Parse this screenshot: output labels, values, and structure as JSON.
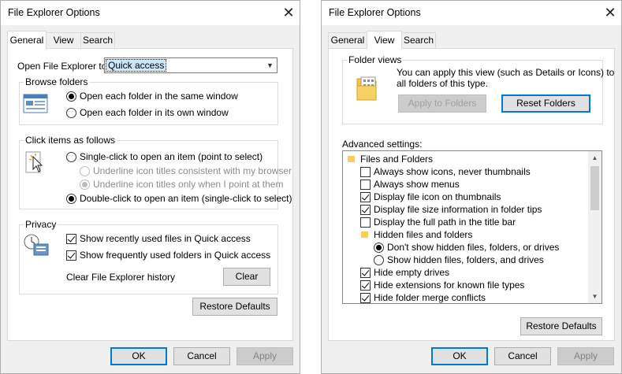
{
  "left_dialog": {
    "title": "File Explorer Options",
    "tabs": [
      "General",
      "View",
      "Search"
    ],
    "open_to_label": "Open File Explorer to:",
    "open_to_value": "Quick access",
    "browse": {
      "title": "Browse folders",
      "opt1": "Open each folder in the same window",
      "opt2": "Open each folder in its own window"
    },
    "click": {
      "title": "Click items as follows",
      "single": "Single-click to open an item (point to select)",
      "sub1": "Underline icon titles consistent with my browser",
      "sub2": "Underline icon titles only when I point at them",
      "double": "Double-click to open an item (single-click to select)"
    },
    "privacy": {
      "title": "Privacy",
      "recent": "Show recently used files in Quick access",
      "frequent": "Show frequently used folders in Quick access",
      "clear_label": "Clear File Explorer history",
      "clear_button": "Clear"
    },
    "restore": "Restore Defaults",
    "ok": "OK",
    "cancel": "Cancel",
    "apply": "Apply"
  },
  "right_dialog": {
    "title": "File Explorer Options",
    "tabs": [
      "General",
      "View",
      "Search"
    ],
    "folder_views": {
      "title": "Folder views",
      "desc1": "You can apply this view (such as Details or Icons) to",
      "desc2": "all folders of this type.",
      "apply_btn": "Apply to Folders",
      "reset_btn": "Reset Folders"
    },
    "advanced_label": "Advanced settings:",
    "items": [
      {
        "type": "folder",
        "label": "Files and Folders",
        "indent": 0
      },
      {
        "type": "check",
        "label": "Always show icons, never thumbnails",
        "checked": false,
        "indent": 1
      },
      {
        "type": "check",
        "label": "Always show menus",
        "checked": false,
        "indent": 1
      },
      {
        "type": "check",
        "label": "Display file icon on thumbnails",
        "checked": true,
        "indent": 1
      },
      {
        "type": "check",
        "label": "Display file size information in folder tips",
        "checked": true,
        "indent": 1
      },
      {
        "type": "check",
        "label": "Display the full path in the title bar",
        "checked": false,
        "indent": 1
      },
      {
        "type": "folder",
        "label": "Hidden files and folders",
        "indent": 1
      },
      {
        "type": "radio",
        "label": "Don't show hidden files, folders, or drives",
        "checked": true,
        "indent": 2
      },
      {
        "type": "radio",
        "label": "Show hidden files, folders, and drives",
        "checked": false,
        "indent": 2
      },
      {
        "type": "check",
        "label": "Hide empty drives",
        "checked": true,
        "indent": 1
      },
      {
        "type": "check",
        "label": "Hide extensions for known file types",
        "checked": true,
        "indent": 1
      },
      {
        "type": "check",
        "label": "Hide folder merge conflicts",
        "checked": true,
        "indent": 1
      }
    ],
    "restore": "Restore Defaults",
    "ok": "OK",
    "cancel": "Cancel",
    "apply": "Apply"
  }
}
